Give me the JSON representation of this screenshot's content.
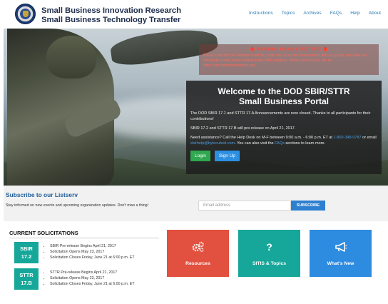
{
  "header": {
    "title_line1": "Small Business Innovation Research",
    "title_line2": "Small Business Technology Transfer",
    "nav": [
      "Instructions",
      "Topics",
      "Archives",
      "FAQs",
      "Help",
      "About"
    ]
  },
  "hero": {
    "test_notice": {
      "title": "WARNING: THIS IS A TEST SITE",
      "text": "Please note that this website is not for public use. It is a test environment and any public use does not constitute a valid action related to the SBIR program. Please visit the live site at: https://sbir.defensebusiness.org/"
    },
    "welcome": {
      "heading_line1": "Welcome to the DOD SBIR/STTR",
      "heading_line2": "Small Business Portal",
      "p1": "The DOD SBIR 17.1 and STTR 17.A Announcements are now closed. Thanks to all participants for their contributions!",
      "p2": "SBIR 17.2 and STTR 17.B will pre-release on April 21, 2017.",
      "p3_a": "Need assistance? Call the Help Desk on M-F between 9:00 a.m. - 6:00 p.m. ET at",
      "p3_phone": "1-800-348-0787",
      "p3_b": "or email",
      "p3_email": "sbirhelp@bytecubed.com",
      "p3_c": ". You can also visit the",
      "p3_faq": "FAQs",
      "p3_d": "sections to learn more.",
      "login": "Login",
      "signup": "Sign Up"
    }
  },
  "listserv": {
    "title": "Subscribe to our Listserv",
    "subtitle": "Stay informed on new events and upcoming organization updates. Don't miss a thing!",
    "email_placeholder": "Email address",
    "subscribe": "SUBSCRIBE"
  },
  "solicitations": {
    "title": "CURRENT SOLICITATIONS",
    "items": [
      {
        "badge_line1": "SBIR",
        "badge_line2": "17.2",
        "lines": [
          "SBIR Pre-release Begins April 21, 2017",
          "Solicitation Opens May 23, 2017",
          "Solicitation Closes Friday, June 21 at 6:00 p.m. ET"
        ]
      },
      {
        "badge_line1": "STTR",
        "badge_line2": "17.B",
        "lines": [
          "STTR Pre-release Begins April 21, 2017",
          "Solicitation Opens May 23, 2017",
          "Solicitation Closes Friday, June 21 at 6:00 p.m. ET"
        ]
      }
    ]
  },
  "tiles": [
    {
      "label": "Resources",
      "icon": "gears-icon",
      "color": "#e2503f"
    },
    {
      "label": "SITIS & Topics",
      "icon": "question-icon",
      "color": "#16a79a"
    },
    {
      "label": "What's New",
      "icon": "megaphone-icon",
      "color": "#2d8be0"
    }
  ]
}
